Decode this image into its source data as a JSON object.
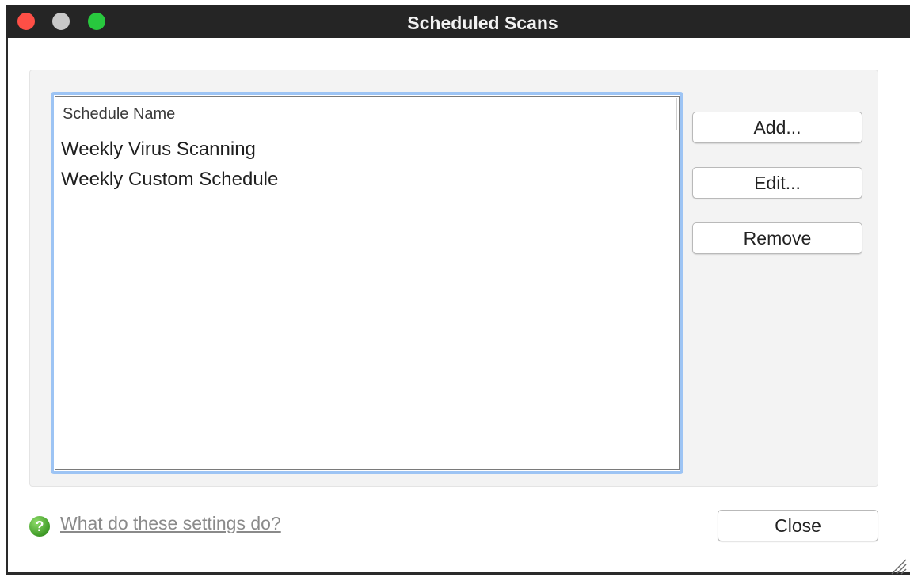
{
  "window": {
    "title": "Scheduled Scans"
  },
  "list": {
    "column_header": "Schedule Name",
    "items": [
      {
        "label": "Weekly Virus Scanning"
      },
      {
        "label": "Weekly Custom Schedule"
      }
    ]
  },
  "buttons": {
    "add": "Add...",
    "edit": "Edit...",
    "remove": "Remove",
    "close": "Close"
  },
  "help": {
    "icon": "question-icon",
    "icon_glyph": "?",
    "link_text": "What do these settings do?"
  },
  "colors": {
    "titlebar": "#252525",
    "close_light": "#fe4f46",
    "minimize_light": "#c8c8c8",
    "maximize_light": "#28c83e",
    "focus_ring": "#9dc4f4",
    "help_green": "#3f9b27"
  }
}
